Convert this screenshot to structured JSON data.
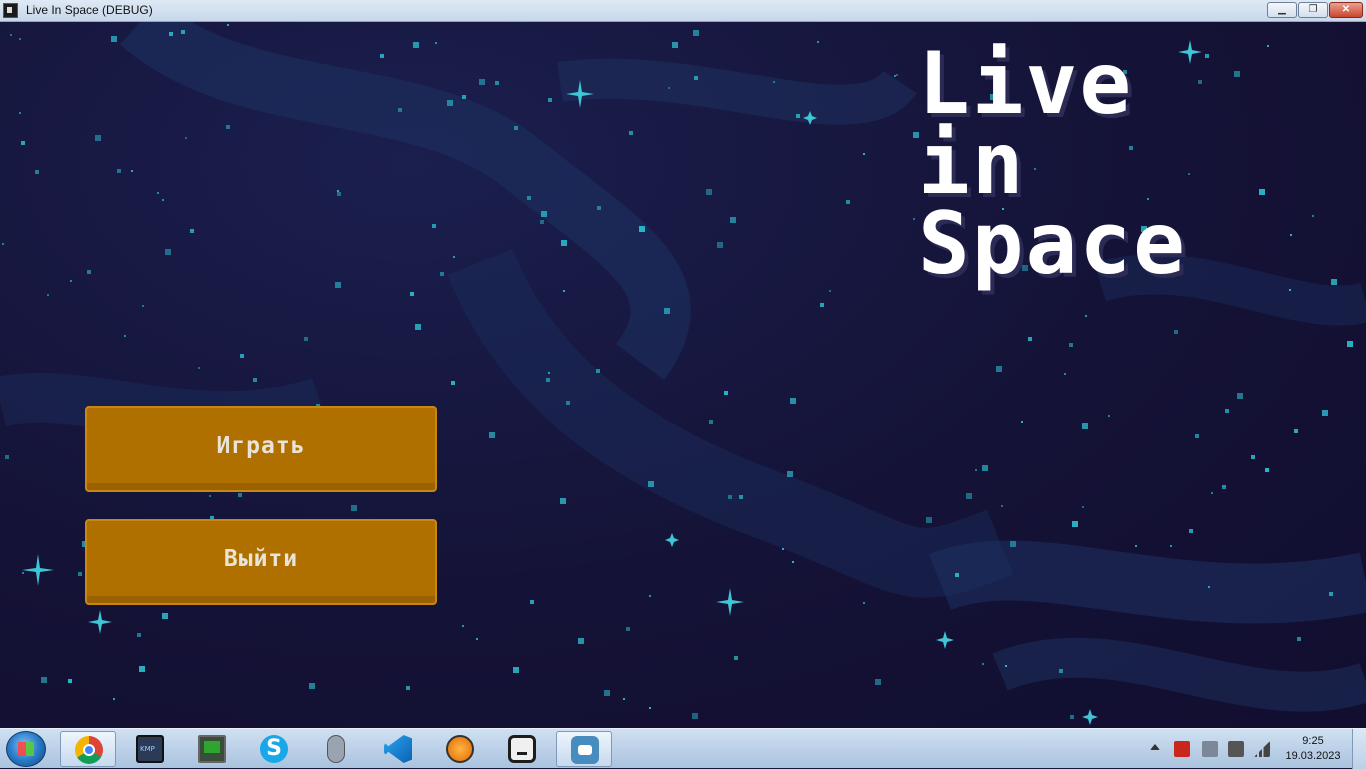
{
  "window": {
    "title": "Live In Space (DEBUG)",
    "controls": {
      "minimize": "▁",
      "maximize": "❐",
      "close": "✕"
    }
  },
  "game": {
    "title_lines": [
      "Live",
      "in",
      "Space"
    ],
    "buttons": {
      "play": "Играть",
      "quit": "Выйти"
    }
  },
  "taskbar": {
    "apps": [
      {
        "name": "chrome-icon",
        "active": true
      },
      {
        "name": "kmplayer-icon",
        "active": false
      },
      {
        "name": "system-monitor-icon",
        "active": false
      },
      {
        "name": "skype-icon",
        "active": false
      },
      {
        "name": "mouse-icon",
        "active": false
      },
      {
        "name": "vscode-icon",
        "active": false
      },
      {
        "name": "fl-studio-icon",
        "active": false
      },
      {
        "name": "app-square-icon",
        "active": false
      },
      {
        "name": "godot-icon",
        "active": true
      }
    ],
    "skype_glyph": "S",
    "clock": {
      "time": "9:25",
      "date": "19.03.2023"
    }
  }
}
